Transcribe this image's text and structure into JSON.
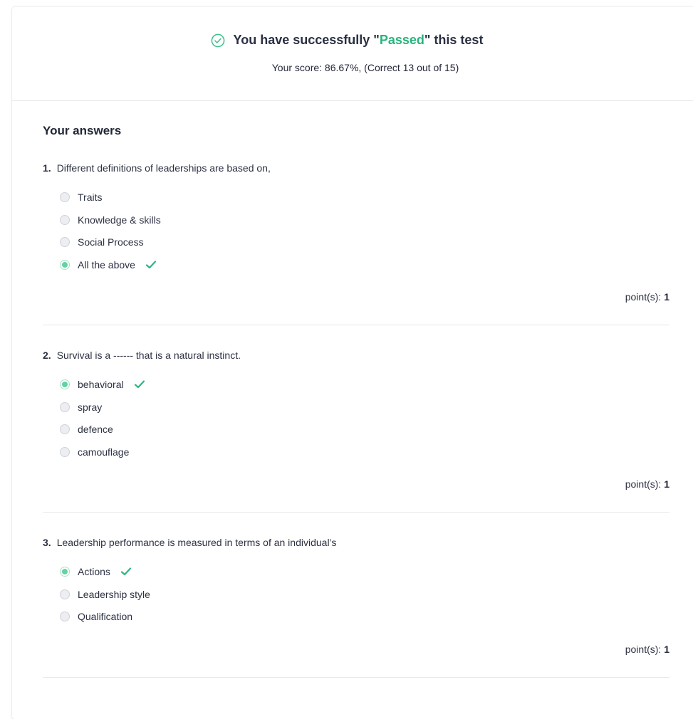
{
  "result": {
    "title_prefix": "You have successfully \"",
    "status": "Passed",
    "title_suffix": "\" this test",
    "score_text": "Your score: 86.67%, (Correct 13 out of 15)",
    "status_icon": "check-circle-icon",
    "accent_color": "#27b47c"
  },
  "answers": {
    "heading": "Your answers",
    "points_label": "point(s):",
    "questions": [
      {
        "number": "1.",
        "text": "Different definitions of leaderships are based on,",
        "options": [
          {
            "label": "Traits",
            "selected": false,
            "correct": false
          },
          {
            "label": "Knowledge & skills",
            "selected": false,
            "correct": false
          },
          {
            "label": "Social Process",
            "selected": false,
            "correct": false
          },
          {
            "label": "All the above",
            "selected": true,
            "correct": true
          }
        ],
        "points": "1"
      },
      {
        "number": "2.",
        "text": "Survival is a ------ that is a natural instinct.",
        "options": [
          {
            "label": "behavioral",
            "selected": true,
            "correct": true
          },
          {
            "label": "spray",
            "selected": false,
            "correct": false
          },
          {
            "label": "defence",
            "selected": false,
            "correct": false
          },
          {
            "label": "camouflage",
            "selected": false,
            "correct": false
          }
        ],
        "points": "1"
      },
      {
        "number": "3.",
        "text": "Leadership performance is measured in terms of an individual’s",
        "options": [
          {
            "label": "Actions",
            "selected": true,
            "correct": true
          },
          {
            "label": "Leadership style",
            "selected": false,
            "correct": false
          },
          {
            "label": "Qualification",
            "selected": false,
            "correct": false
          }
        ],
        "points": "1"
      }
    ]
  }
}
